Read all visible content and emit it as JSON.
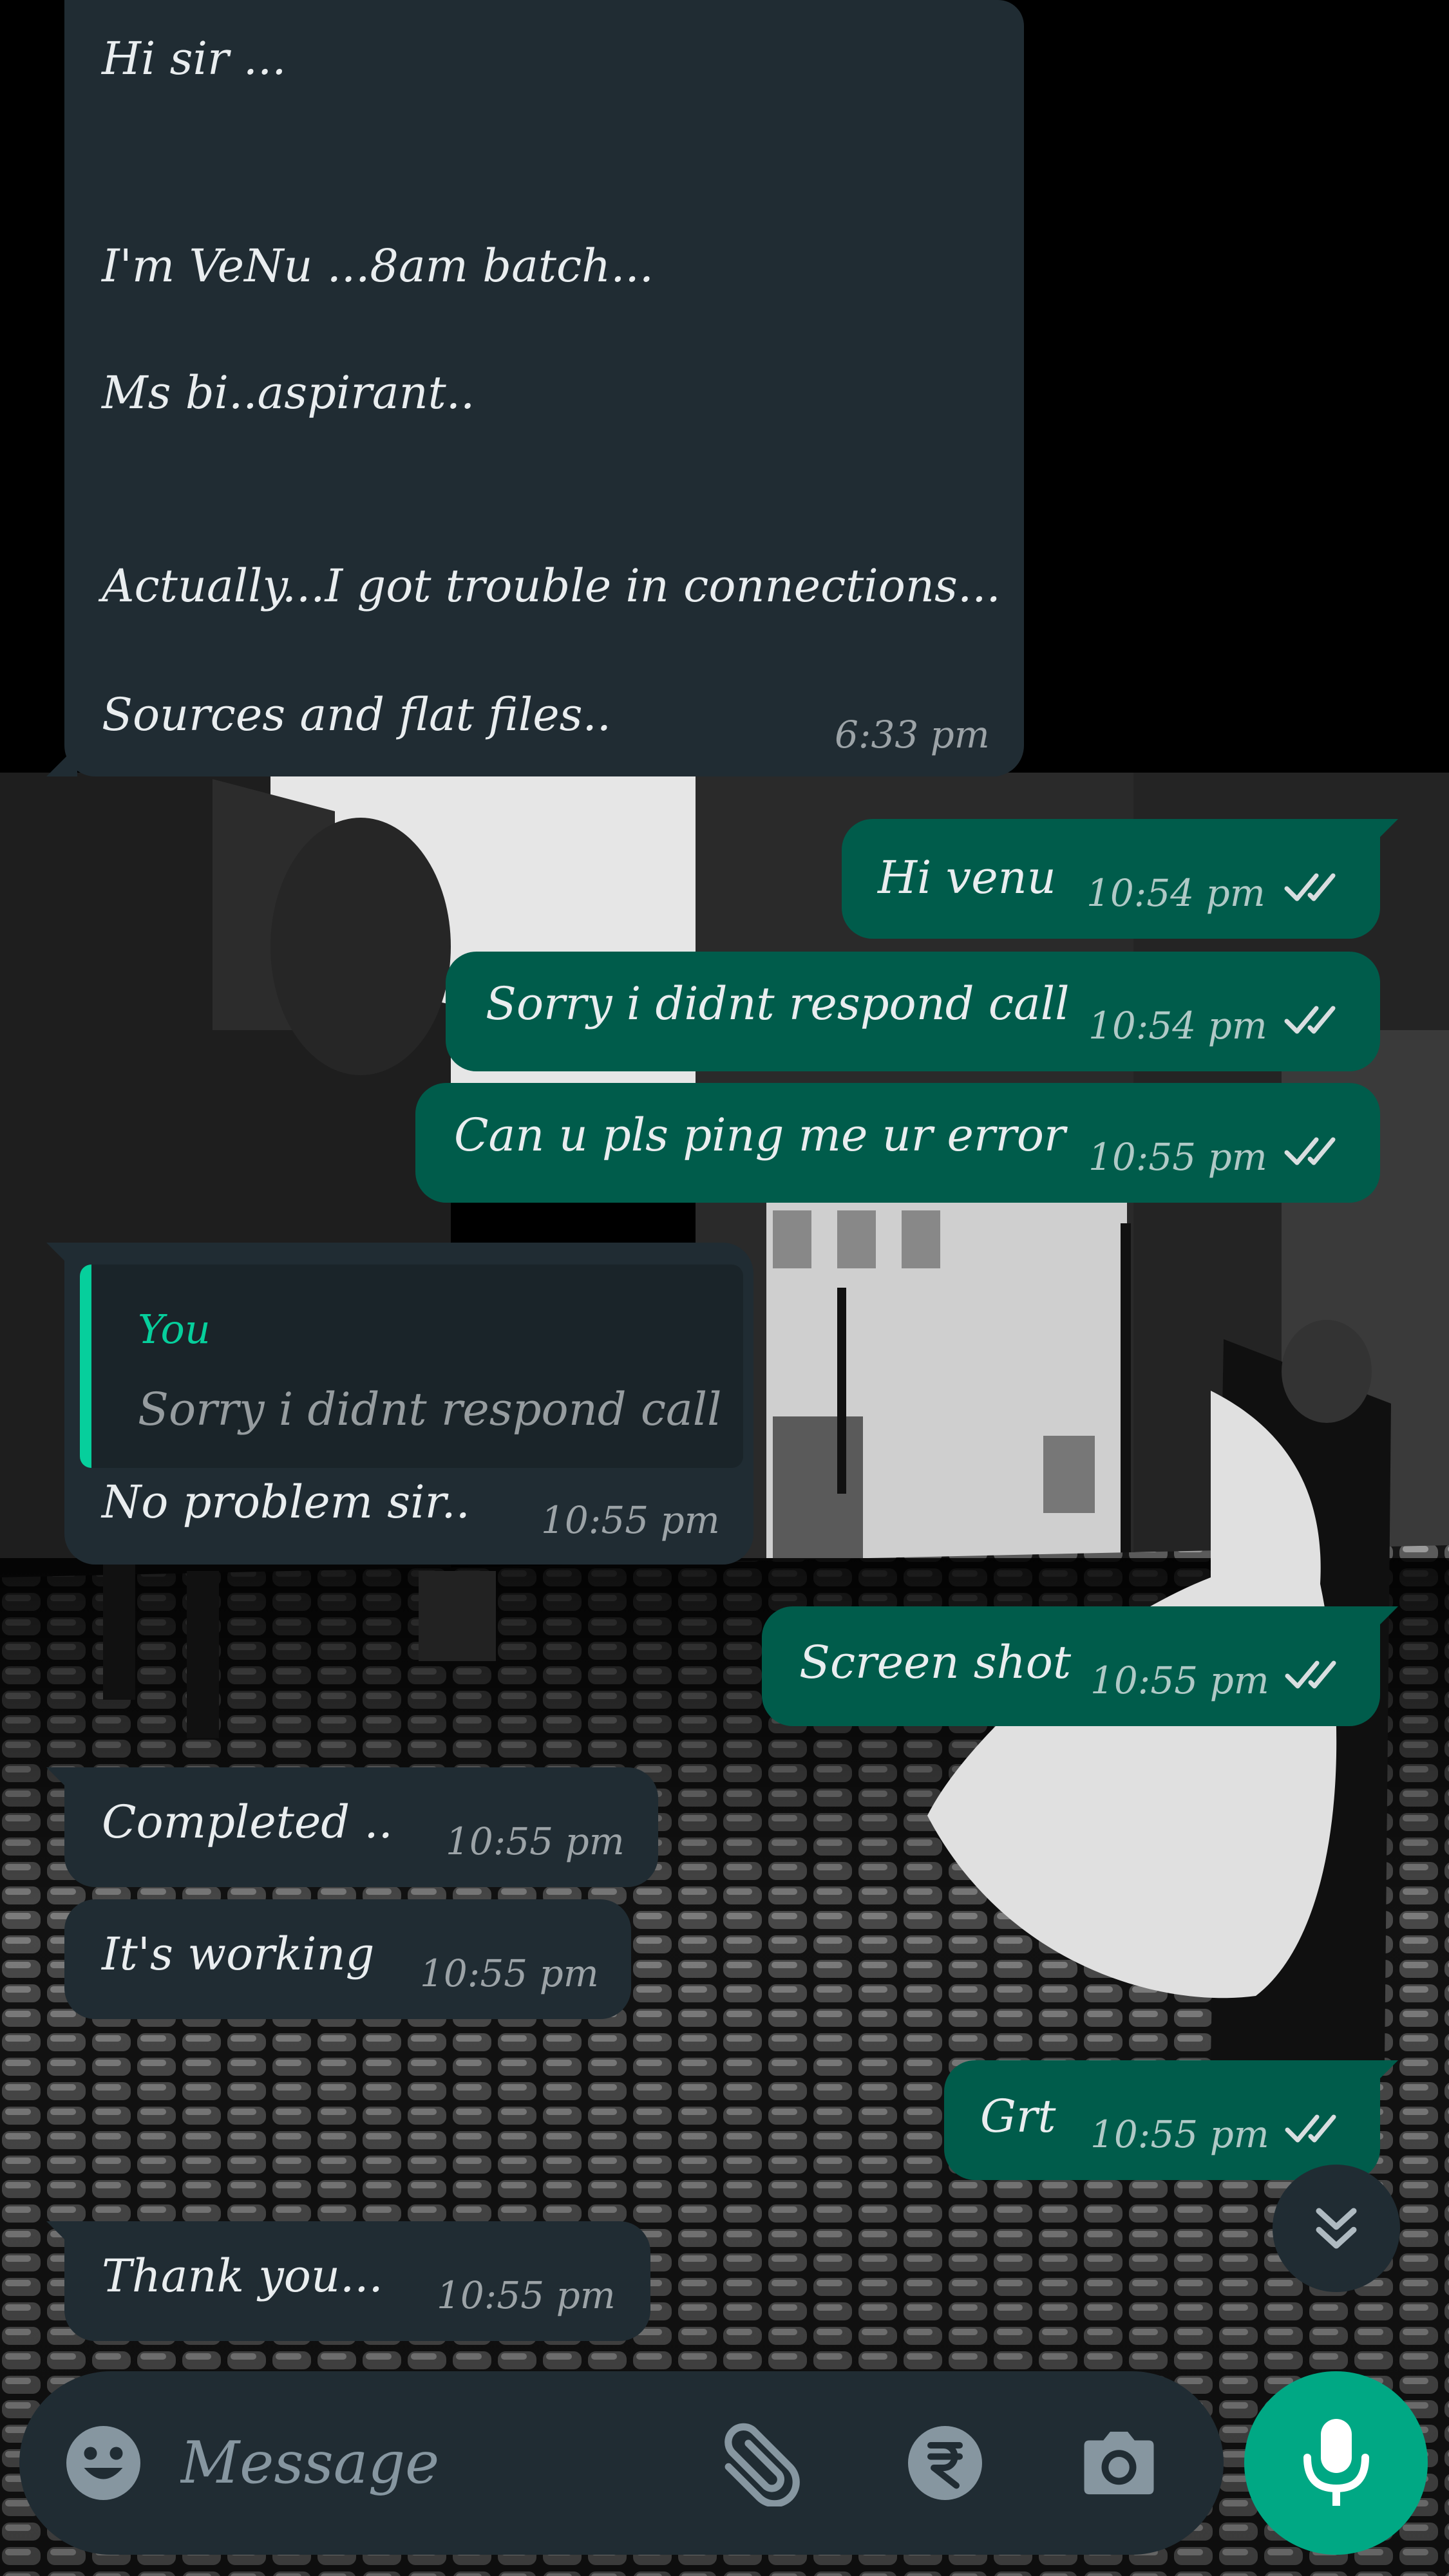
{
  "messages": [
    {
      "direction": "incoming",
      "lines": [
        "Hi sir ...",
        "I'm VeNu ...8am batch...",
        "Ms bi..aspirant..",
        "Actually...I got trouble in connections...",
        "Sources and flat files.."
      ],
      "time": "6:33 pm"
    },
    {
      "direction": "outgoing",
      "text": "Hi venu",
      "time": "10:54 pm",
      "status": "read"
    },
    {
      "direction": "outgoing",
      "text": "Sorry i didnt respond call",
      "time": "10:54 pm",
      "status": "read"
    },
    {
      "direction": "outgoing",
      "text": "Can u pls ping me ur error",
      "time": "10:55 pm",
      "status": "read"
    },
    {
      "direction": "incoming",
      "reply_to": {
        "author": "You",
        "text": "Sorry i didnt respond call"
      },
      "text": "No problem  sir..",
      "time": "10:55 pm"
    },
    {
      "direction": "outgoing",
      "text": "Screen shot",
      "time": "10:55 pm",
      "status": "read"
    },
    {
      "direction": "incoming",
      "text": "Completed ..",
      "time": "10:55 pm"
    },
    {
      "direction": "incoming",
      "text": "It's working",
      "time": "10:55 pm"
    },
    {
      "direction": "outgoing",
      "text": "Grt",
      "time": "10:55 pm",
      "status": "read"
    },
    {
      "direction": "incoming",
      "text": "Thank you...",
      "time": "10:55 pm"
    }
  ],
  "composer": {
    "placeholder": "Message",
    "icons": [
      "emoji-icon",
      "attach-icon",
      "rupee-payment-icon",
      "camera-icon",
      "mic-icon"
    ]
  },
  "controls": {
    "scroll_down_icon": "chevron-double-down-icon"
  },
  "colors": {
    "incoming_bubble": "#202c33",
    "outgoing_bubble": "#005c4b",
    "accent": "#00a884",
    "read_ticks": "#d9dee0"
  }
}
